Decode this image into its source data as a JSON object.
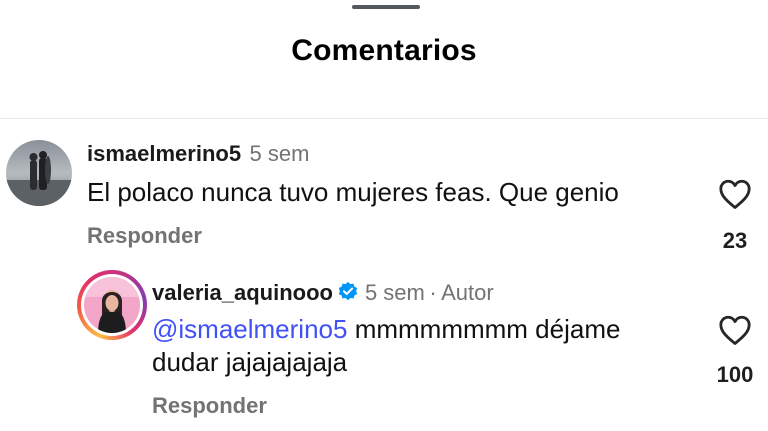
{
  "sheet": {
    "title": "Comentarios"
  },
  "comments": [
    {
      "username": "ismaelmerino5",
      "time": "5 sem",
      "text": "El polaco nunca tuvo mujeres feas. Que genio",
      "reply_label": "Responder",
      "likes": "23"
    },
    {
      "username": "valeria_aquinooo",
      "verified": true,
      "time": "5 sem",
      "separator": "·",
      "author_label": "Autor",
      "mention": "@ismaelmerino5",
      "text_line1": " mmmmmmmm déjame",
      "text_line2": "dudar jajajajajaja",
      "reply_label": "Responder",
      "likes": "100"
    }
  ],
  "icons": {
    "like": "heart-outline-icon",
    "verified": "verified-badge-icon"
  },
  "colors": {
    "mention": "#4150f7",
    "verified": "#0095f6",
    "meta": "#737373"
  }
}
